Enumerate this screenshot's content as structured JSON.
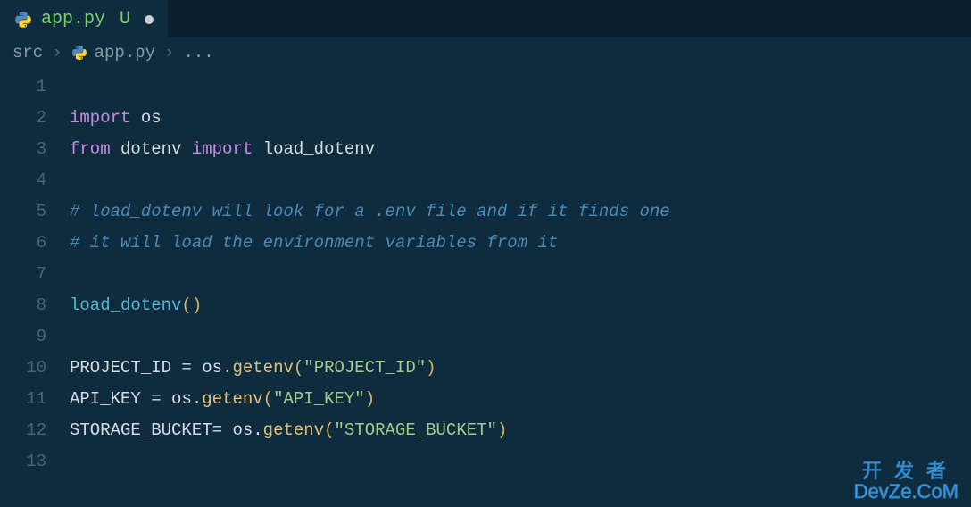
{
  "tab": {
    "filename": "app.py",
    "status_letter": "U"
  },
  "breadcrumb": {
    "seg0": "src",
    "seg1": "app.py",
    "seg2": "..."
  },
  "lines": {
    "n1": "1",
    "n2": "2",
    "n3": "3",
    "n4": "4",
    "n5": "5",
    "n6": "6",
    "n7": "7",
    "n8": "8",
    "n9": "9",
    "n10": "10",
    "n11": "11",
    "n12": "12",
    "n13": "13"
  },
  "code": {
    "l2": {
      "import": "import",
      "os": "os"
    },
    "l3": {
      "from": "from",
      "dotenv": "dotenv",
      "import": "import",
      "load_dotenv": "load_dotenv"
    },
    "l5": "# load_dotenv will look for a .env file and if it finds one",
    "l6": "# it will load the environment variables from it",
    "l8": {
      "call": "load_dotenv",
      "parens": "()"
    },
    "l10": {
      "var": "PROJECT_ID",
      "eq": " = ",
      "obj": "os",
      "method": "getenv",
      "arg": "\"PROJECT_ID\""
    },
    "l11": {
      "var": "API_KEY",
      "eq": " = ",
      "obj": "os",
      "method": "getenv",
      "arg": "\"API_KEY\""
    },
    "l12": {
      "var": "STORAGE_BUCKET",
      "eq": "= ",
      "obj": "os",
      "method": "getenv",
      "arg": "\"STORAGE_BUCKET\""
    }
  },
  "watermark": {
    "cn": "开发者",
    "en": "DevZe.CoM"
  }
}
